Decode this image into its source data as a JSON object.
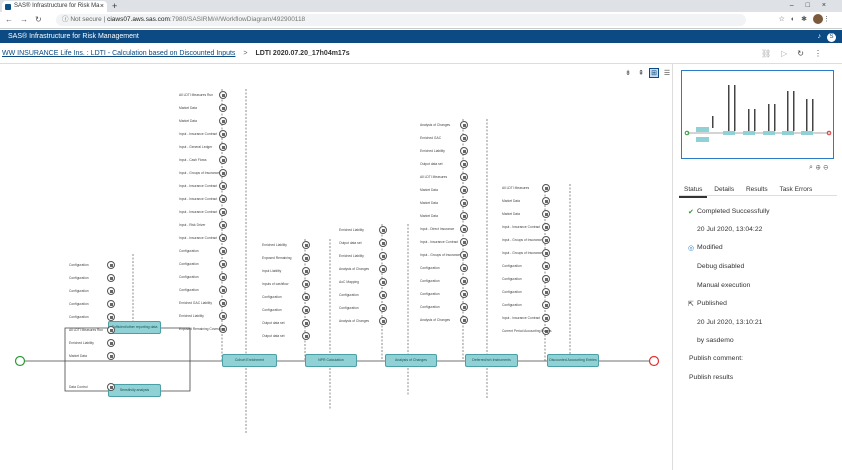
{
  "browser": {
    "tab_title": "SAS® Infrastructure for Risk Ma",
    "new_tab": "+",
    "security": "Not secure",
    "url_domain": "ciaws07.aws.sas.com",
    "url_path": ":7980/SASIRM/#/WorkflowDiagram/492900118"
  },
  "app": {
    "title": "SAS® Infrastructure for Risk Management",
    "user_initial": "S"
  },
  "breadcrumb": {
    "parent": "WW INSURANCE Life Ins. : LDTI - Calculation based on Discounted Inputs",
    "separator": ">",
    "current": "LDTI 2020.07.20_17h04m17s"
  },
  "workflow": {
    "nodes": [
      {
        "label": "Sufficient/other reporting data"
      },
      {
        "label": "Sensitivity analysis"
      },
      {
        "label": "Cohort Enrichment"
      },
      {
        "label": "NPR Calculation"
      },
      {
        "label": "Analysis of Changes"
      },
      {
        "label": "Deferred/rch Instruments"
      },
      {
        "label": "Discounted Accounting Entries"
      }
    ],
    "labels_left": [
      "Configuration",
      "Configuration",
      "Configuration",
      "Configuration",
      "Configuration",
      "All LDTI Measures Run",
      "Enriched Liability",
      "Market Data",
      "Data Control"
    ],
    "labels_col2": [
      "All LDTI Measures Run",
      "Market Data",
      "Market Data",
      "Input - Insurance Contract",
      "Input - General Ledger",
      "Input - Cash Flows",
      "Input - Groups of Insurance",
      "Input - Insurance Contract",
      "Input - Insurance Contract",
      "Input - Insurance Contract",
      "Input - Risk Driver",
      "Input - Insurance Contract",
      "Configuration",
      "Configuration",
      "Configuration",
      "Configuration",
      "Enriched GAC Liability",
      "Enriched Liability",
      "Exposed Remaining Coverage"
    ],
    "labels_col3": [
      "Enriched Liability",
      "Exposed Remaining",
      "Input Liability",
      "Inputs of cashflow",
      "Configuration",
      "Configuration",
      "Output data set",
      "Output data set"
    ],
    "labels_col4": [
      "Enriched Liability",
      "Output data set",
      "Enriched Liability",
      "Analysis of Changes",
      "AoC Mapping",
      "Configuration",
      "Configuration",
      "Analysis of Changes"
    ],
    "labels_col5": [
      "Analysis of Changes",
      "Enriched GAC",
      "Enriched Liability",
      "Output data set",
      "All LDTI Measures",
      "Market Data",
      "Market Data",
      "Market Data",
      "Input - Direct Insurance",
      "Input - Insurance Contract",
      "Input - Groups of Insurance",
      "Configuration",
      "Configuration",
      "Configuration",
      "Configuration",
      "Analysis of Changes"
    ],
    "labels_col6": [
      "All LDTI Measures",
      "Market Data",
      "Market Data",
      "Input - Insurance Contract",
      "Input - Groups of Insurance",
      "Input - Groups of Insurance",
      "Configuration",
      "Configuration",
      "Configuration",
      "Configuration",
      "Input - Insurance Contract",
      "Current Period Accounting Events"
    ]
  },
  "panel": {
    "tabs": [
      "Status",
      "Details",
      "Results",
      "Task Errors"
    ],
    "status_completed": "Completed Successfully",
    "status_completed_date": "20 Jul 2020, 13:04:22",
    "modified": "Modified",
    "debug": "Debug disabled",
    "manual": "Manual execution",
    "published": "Published",
    "published_date": "20 Jul 2020, 13:10:21",
    "published_by": "by sasdemo",
    "publish_comment": "Publish comment:",
    "publish_results": "Publish results"
  },
  "colors": {
    "header": "#0b4a82",
    "node": "#8fd1d4",
    "success": "#2c9a3a"
  }
}
